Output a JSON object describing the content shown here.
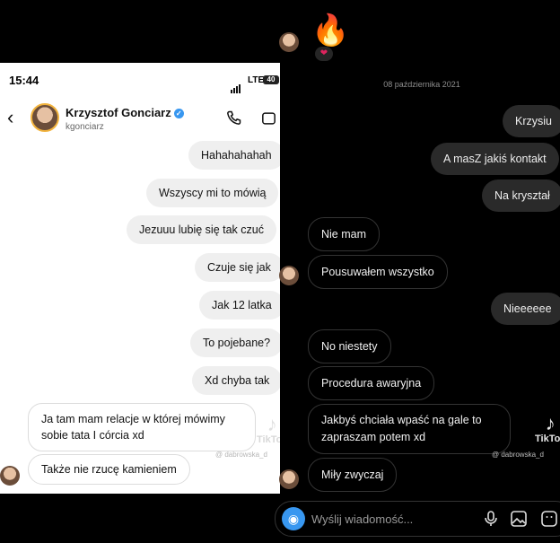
{
  "left": {
    "status": {
      "time": "15:44",
      "network": "LTE",
      "battery": "40"
    },
    "header": {
      "name": "Krzysztof Gonciarz",
      "handle": "kgonciarz"
    },
    "sent": [
      "Hahahahahah",
      "Wszyscy mi to mówią",
      "Jezuuu lubię się tak czuć",
      "Czuje się jak",
      "Jak 12 latka",
      "To pojebane?",
      "Xd chyba tak"
    ],
    "received": [
      "Ja tam mam relacje w której mówimy sobie tata I córcia xd",
      "Także nie rzucę kamieniem"
    ],
    "watermark": {
      "brand": "TikTok",
      "user": "@ dabrowska_d"
    }
  },
  "right": {
    "reaction": {
      "emoji": "🔥",
      "heart": "❤"
    },
    "date": "08 października 2021",
    "sent": [
      "Krzysiu",
      "A masZ jakiś kontakt",
      "Na kryształ",
      "Nieeeeee"
    ],
    "received": [
      "Nie mam",
      "Pousuwałem wszystko",
      "No niestety",
      "Procedura awaryjna",
      "Jakbyś chciała wpaść na gale to zapraszam potem xd",
      "Miły zwyczaj"
    ],
    "composer": {
      "placeholder": "Wyślij wiadomość..."
    },
    "watermark": {
      "brand": "TikTok",
      "user": "@ dabrowska_d"
    }
  }
}
